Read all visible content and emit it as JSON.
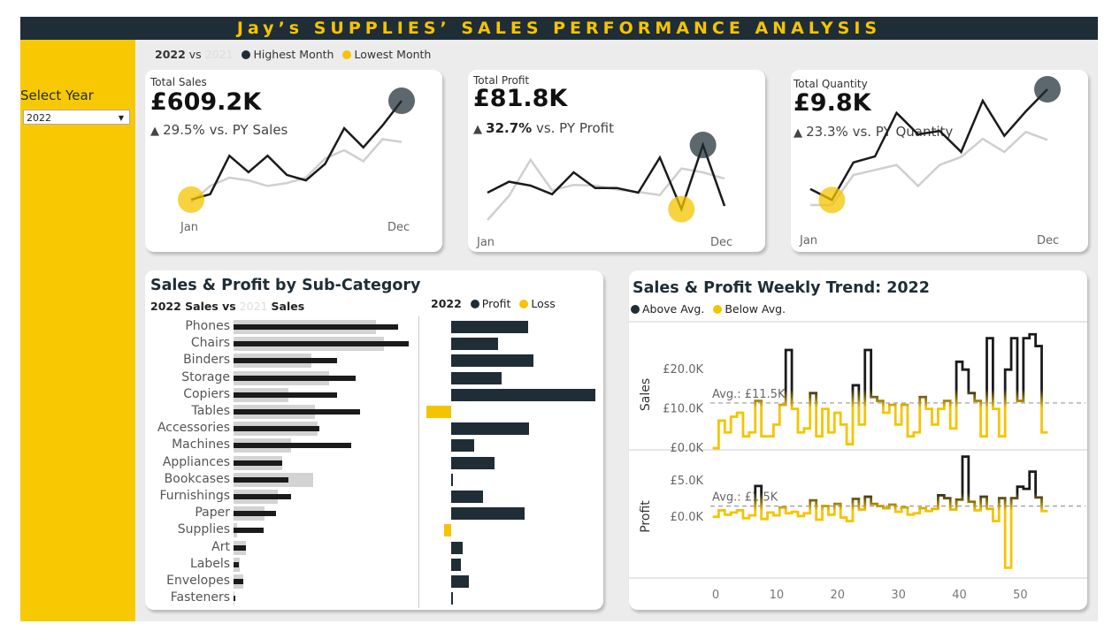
{
  "title": "Jay’s SUPPLIES’ SALES PERFORMANCE ANALYSIS",
  "filter": {
    "label": "Select Year",
    "selected": "2022"
  },
  "legend_top": {
    "current": "2022",
    "vs": "vs",
    "previous": "2021",
    "highest": "Highest Month",
    "lowest": "Lowest Month"
  },
  "colors": {
    "dark": "#1f2d36",
    "yellow": "#f5c400",
    "gray": "#cccccc",
    "bg": "#ececec"
  },
  "kpis": [
    {
      "label": "Total Sales",
      "value": "£609.2K",
      "change_pct": "29.5%",
      "change_text": "vs. PY Sales",
      "start": "Jan",
      "end": "Dec",
      "current": [
        14,
        16,
        30,
        24,
        30,
        23,
        21,
        27,
        40,
        33,
        41,
        50
      ],
      "previous": [
        13,
        19,
        22,
        21,
        19,
        20,
        22,
        29,
        32,
        28,
        36,
        35
      ]
    },
    {
      "label": "Total Profit",
      "value": "£81.8K",
      "change_pct": "32.7%",
      "change_text": "vs. PY Profit",
      "start": "Jan",
      "end": "Dec",
      "current": [
        3.5,
        4.9,
        4.4,
        3.3,
        6.1,
        4.1,
        4.1,
        3.5,
        8.0,
        1.4,
        9.6,
        1.8
      ],
      "previous": [
        0.0,
        3.1,
        7.7,
        3.8,
        4.5,
        4.4,
        3.9,
        3.6,
        3.2,
        6.6,
        6.1,
        5.3
      ]
    },
    {
      "label": "Total Quantity",
      "value": "£9.8K",
      "change_pct": "23.3%",
      "change_text": "vs. PY Quantity",
      "start": "Jan",
      "end": "Dec",
      "current": [
        590,
        480,
        855,
        915,
        1350,
        1135,
        1170,
        960,
        1470,
        1120,
        1365,
        1585
      ],
      "previous": [
        430,
        430,
        730,
        780,
        830,
        620,
        830,
        910,
        1090,
        960,
        1160,
        1080
      ]
    }
  ],
  "subcat": {
    "title": "Sales & Profit by Sub-Category",
    "legend_current": "2022 Sales vs",
    "legend_prev": "2021",
    "legend_tail": "Sales",
    "profit_legend_year": "2022",
    "profit_label": "Profit",
    "loss_label": "Loss",
    "categories": [
      "Phones",
      "Chairs",
      "Binders",
      "Storage",
      "Copiers",
      "Tables",
      "Accessories",
      "Machines",
      "Appliances",
      "Bookcases",
      "Furnishings",
      "Paper",
      "Supplies",
      "Art",
      "Labels",
      "Envelopes",
      "Fasteners"
    ],
    "sales_2022": [
      105000,
      112000,
      66000,
      78000,
      66000,
      81000,
      55000,
      75000,
      31000,
      35000,
      37000,
      27000,
      19000,
      8000,
      3500,
      6000,
      1000
    ],
    "sales_2021": [
      91000,
      96000,
      50000,
      61000,
      35000,
      52000,
      54000,
      37000,
      31000,
      51000,
      28000,
      20000,
      2000,
      8000,
      4000,
      6000,
      800
    ],
    "profit_2022": [
      12000,
      7300,
      12900,
      7900,
      22500,
      -3800,
      12200,
      3600,
      6700,
      300,
      5000,
      11500,
      -1100,
      1800,
      1500,
      2700,
      200
    ]
  },
  "weekly": {
    "title": "Sales & Profit Weekly Trend: 2022",
    "above": "Above Avg.",
    "below": "Below Avg.",
    "sales_axis": "Sales",
    "profit_axis": "Profit",
    "sales_ticks": [
      "£20.0K",
      "£10.0K",
      "£0.0K"
    ],
    "profit_ticks": [
      "£5.0K",
      "£0.0K"
    ],
    "sales_avg_label": "Avg.: £11.5K",
    "profit_avg_label": "Avg.: £1.5K",
    "sales_avg": 11500,
    "profit_avg": 1500,
    "x_ticks": [
      "0",
      "10",
      "20",
      "30",
      "40",
      "50"
    ],
    "sales": [
      0,
      7000,
      4000,
      8000,
      9000,
      3000,
      4000,
      12000,
      3000,
      3000,
      6000,
      11000,
      25000,
      10000,
      4000,
      5000,
      14000,
      3000,
      10000,
      4000,
      9000,
      6000,
      1000,
      16000,
      6000,
      25000,
      13000,
      12000,
      9000,
      11000,
      6000,
      11000,
      3000,
      4000,
      13000,
      10000,
      6000,
      10000,
      12000,
      5000,
      22000,
      20000,
      14000,
      12000,
      3000,
      28000,
      10000,
      3000,
      20000,
      28000,
      12000,
      28000,
      29000,
      26000,
      4000
    ],
    "profit": [
      0,
      900,
      300,
      600,
      900,
      -200,
      200,
      4300,
      -300,
      600,
      200,
      1300,
      500,
      700,
      100,
      500,
      2300,
      -400,
      1500,
      300,
      1800,
      -100,
      -600,
      2500,
      1000,
      2800,
      1800,
      1500,
      1200,
      1700,
      700,
      1300,
      300,
      500,
      1200,
      800,
      1100,
      3000,
      2600,
      1000,
      2400,
      8400,
      2100,
      900,
      2800,
      1100,
      -600,
      2600,
      -7100,
      2600,
      4200,
      3900,
      6300,
      2700,
      800
    ]
  }
}
